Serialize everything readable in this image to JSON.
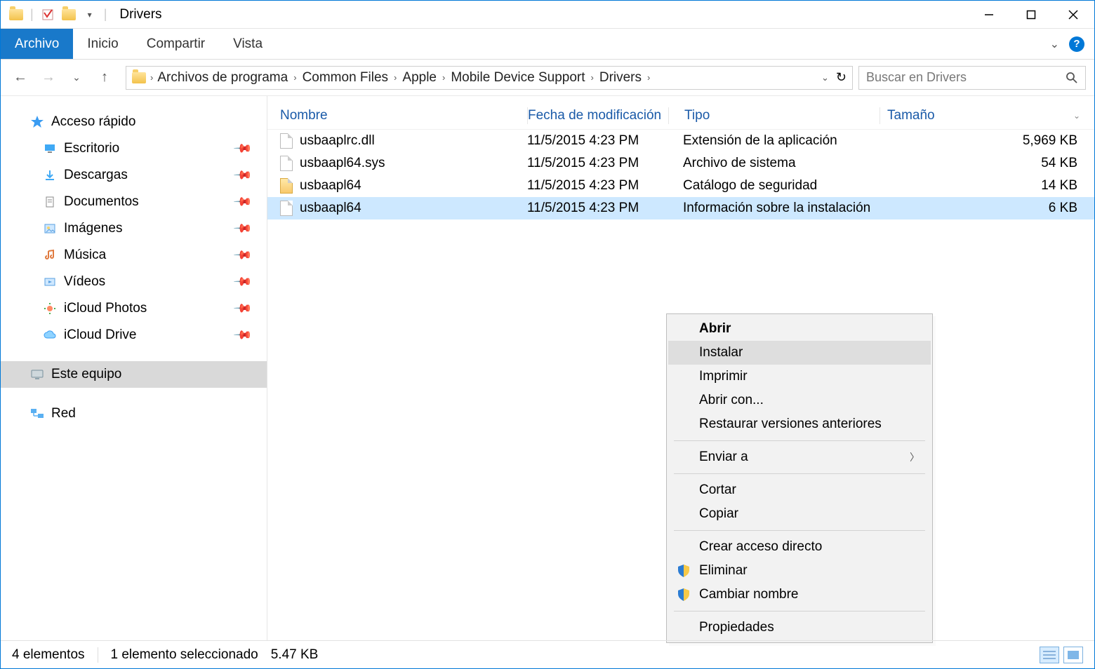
{
  "title": "Drivers",
  "ribbon": {
    "archivo": "Archivo",
    "inicio": "Inicio",
    "compartir": "Compartir",
    "vista": "Vista"
  },
  "breadcrumbs": [
    "Archivos de programa",
    "Common Files",
    "Apple",
    "Mobile Device Support",
    "Drivers"
  ],
  "search_placeholder": "Buscar en Drivers",
  "sidebar": {
    "quick_access": "Acceso rápido",
    "items": [
      {
        "label": "Escritorio",
        "pinned": true
      },
      {
        "label": "Descargas",
        "pinned": true
      },
      {
        "label": "Documentos",
        "pinned": true
      },
      {
        "label": "Imágenes",
        "pinned": true
      },
      {
        "label": "Música",
        "pinned": true
      },
      {
        "label": "Vídeos",
        "pinned": true
      },
      {
        "label": "iCloud Photos",
        "pinned": true
      },
      {
        "label": "iCloud Drive",
        "pinned": true
      }
    ],
    "this_pc": "Este equipo",
    "network": "Red"
  },
  "columns": {
    "name": "Nombre",
    "date": "Fecha de modificación",
    "type": "Tipo",
    "size": "Tamaño"
  },
  "files": [
    {
      "name": "usbaaplrc.dll",
      "date": "11/5/2015 4:23 PM",
      "type": "Extensión de la aplicación",
      "size": "5,969 KB",
      "icon": "dll"
    },
    {
      "name": "usbaapl64.sys",
      "date": "11/5/2015 4:23 PM",
      "type": "Archivo de sistema",
      "size": "54 KB",
      "icon": "sys"
    },
    {
      "name": "usbaapl64",
      "date": "11/5/2015 4:23 PM",
      "type": "Catálogo de seguridad",
      "size": "14 KB",
      "icon": "cat"
    },
    {
      "name": "usbaapl64",
      "date": "11/5/2015 4:23 PM",
      "type": "Información sobre la instalación",
      "size": "6 KB",
      "icon": "inf",
      "selected": true
    }
  ],
  "context_menu": [
    {
      "label": "Abrir",
      "bold": true
    },
    {
      "label": "Instalar",
      "hover": true
    },
    {
      "label": "Imprimir"
    },
    {
      "label": "Abrir con..."
    },
    {
      "label": "Restaurar versiones anteriores"
    },
    {
      "sep": true
    },
    {
      "label": "Enviar a",
      "submenu": true
    },
    {
      "sep": true
    },
    {
      "label": "Cortar"
    },
    {
      "label": "Copiar"
    },
    {
      "sep": true
    },
    {
      "label": "Crear acceso directo"
    },
    {
      "label": "Eliminar",
      "shield": true
    },
    {
      "label": "Cambiar nombre",
      "shield": true
    },
    {
      "sep": true
    },
    {
      "label": "Propiedades"
    }
  ],
  "statusbar": {
    "count": "4 elementos",
    "selection": "1 elemento seleccionado",
    "size": "5.47 KB"
  }
}
